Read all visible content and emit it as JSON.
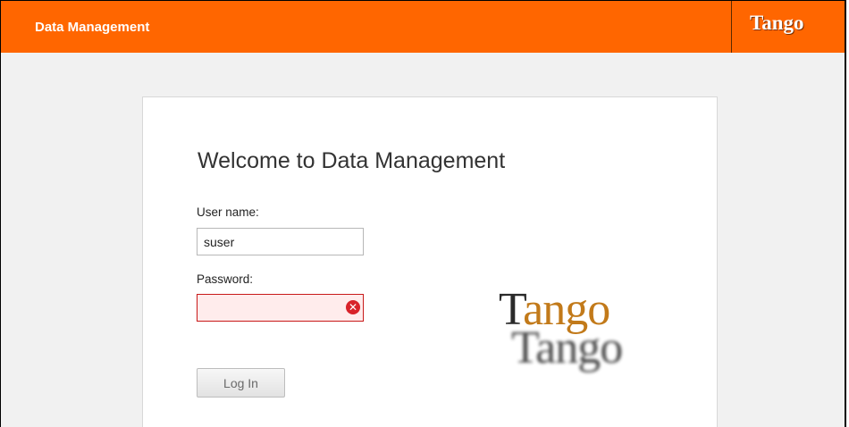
{
  "header": {
    "app_title": "Data Management",
    "brand": "Tango"
  },
  "login": {
    "welcome": "Welcome to Data Management",
    "username_label": "User name:",
    "username_value": "suser",
    "password_label": "Password:",
    "password_value": "",
    "password_state": "error",
    "error_icon": "error-x-icon",
    "login_button": "Log In"
  },
  "logo": {
    "text": "Tango",
    "reflection": "Tango"
  },
  "colors": {
    "header_bg": "#ff6600",
    "error_border": "#c81919",
    "error_bg": "#ffecec",
    "logo_gold": "#c27a1a"
  }
}
